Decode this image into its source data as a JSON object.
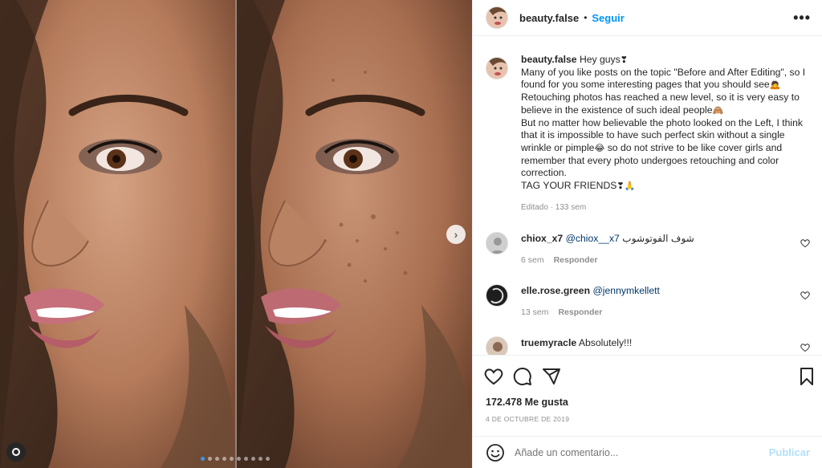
{
  "post": {
    "username": "beauty.false",
    "follow_label": "Seguir",
    "separator": "•",
    "more_label": "•••"
  },
  "caption": {
    "username": "beauty.false",
    "lines": [
      "Hey guys",
      "Many of you like posts on the topic \"Before and After Editing\", so I found for you some interesting pages that you should see",
      "Retouching photos has reached a new level, so it is very easy to believe in the existence of such ideal people",
      "But no matter how believable the photo looked on the Left, I think that it is impossible to have such perfect skin without a single wrinkle or pimple",
      "so do not strive to be like cover girls and remember that every photo undergoes retouching and color correction.",
      "TAG YOUR FRIENDS"
    ],
    "emojis": [
      "❣",
      "🙇",
      "🙈",
      "😂",
      "❣🙏"
    ],
    "meta": "Editado · 133 sem"
  },
  "comments": [
    {
      "username": "chiox_x7",
      "mention": "@chiox__x7",
      "text": "شوف الفوتوشوب",
      "age": "6 sem",
      "reply": "Responder"
    },
    {
      "username": "elle.rose.green",
      "mention": "@jennymkellett",
      "text": "",
      "age": "13 sem",
      "reply": "Responder"
    },
    {
      "username": "truemyracle",
      "mention": "",
      "text": "Absolutely!!!",
      "age": "",
      "reply": ""
    }
  ],
  "stats": {
    "likes": "172.478 Me gusta",
    "date": "4 DE OCTUBRE DE 2019"
  },
  "composer": {
    "placeholder": "Añade un comentario...",
    "publish_label": "Publicar"
  },
  "carousel": {
    "slide_count": 10,
    "active_index": 0,
    "next_glyph": "›"
  },
  "colors": {
    "accent": "#0095f6",
    "muted": "#8e8e8e",
    "border": "#efefef",
    "publish_disabled": "#b2dffc"
  },
  "icons": [
    "heart-icon",
    "comment-icon",
    "share-icon",
    "bookmark-icon",
    "emoji-icon",
    "chevron-right-icon",
    "user-tag-icon"
  ]
}
